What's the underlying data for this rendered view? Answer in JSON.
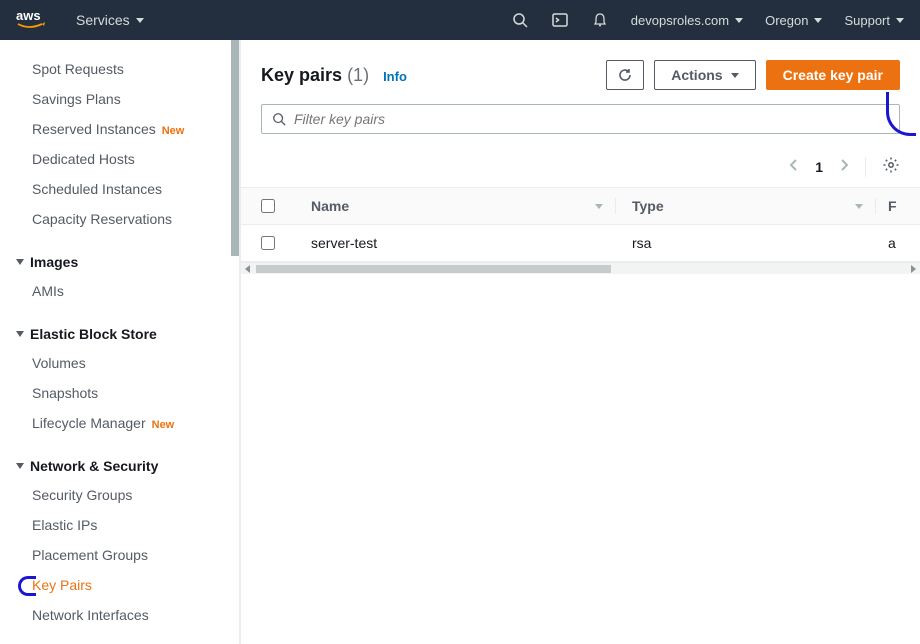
{
  "topnav": {
    "services": "Services",
    "account": "devopsroles.com",
    "region": "Oregon",
    "support": "Support"
  },
  "sidebar": {
    "items": [
      {
        "label": "Spot Requests"
      },
      {
        "label": "Savings Plans"
      },
      {
        "label": "Reserved Instances",
        "new": true
      },
      {
        "label": "Dedicated Hosts"
      },
      {
        "label": "Scheduled Instances"
      },
      {
        "label": "Capacity Reservations"
      }
    ],
    "group_images": "Images",
    "images_items": [
      {
        "label": "AMIs"
      }
    ],
    "group_ebs": "Elastic Block Store",
    "ebs_items": [
      {
        "label": "Volumes"
      },
      {
        "label": "Snapshots"
      },
      {
        "label": "Lifecycle Manager",
        "new": true
      }
    ],
    "group_network": "Network & Security",
    "network_items": [
      {
        "label": "Security Groups"
      },
      {
        "label": "Elastic IPs"
      },
      {
        "label": "Placement Groups"
      },
      {
        "label": "Key Pairs",
        "active": true
      },
      {
        "label": "Network Interfaces"
      }
    ],
    "new_badge": "New"
  },
  "header": {
    "title": "Key pairs",
    "count": "(1)",
    "info": "Info",
    "actions": "Actions",
    "create": "Create key pair"
  },
  "filter": {
    "placeholder": "Filter key pairs"
  },
  "pagination": {
    "page": "1"
  },
  "table": {
    "columns": {
      "name": "Name",
      "type": "Type",
      "extra": "F"
    },
    "rows": [
      {
        "name": "server-test",
        "type": "rsa",
        "extra": "a"
      }
    ]
  }
}
